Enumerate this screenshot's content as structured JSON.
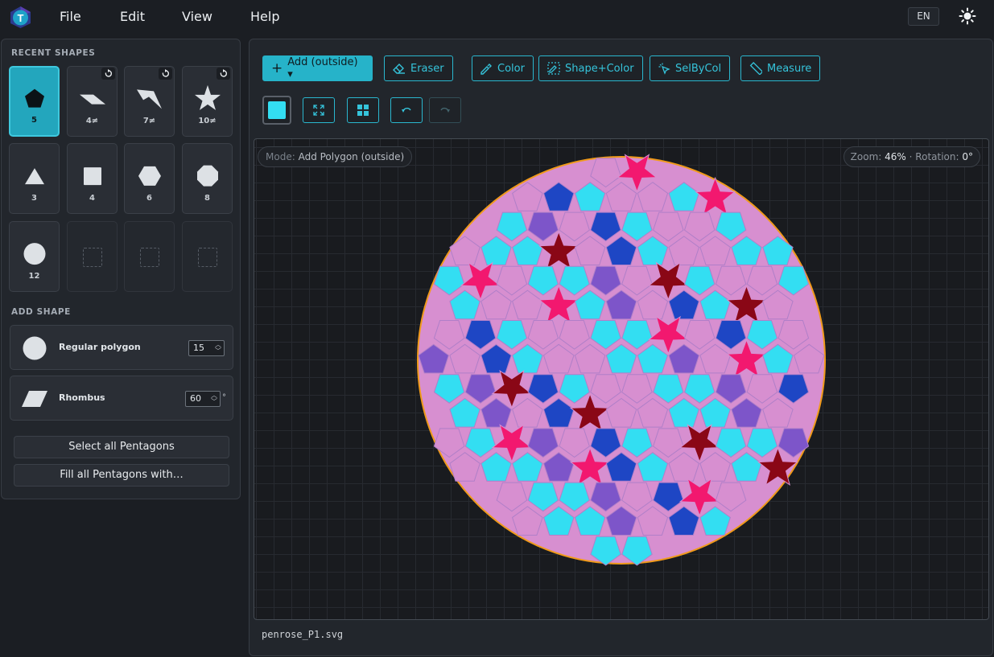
{
  "menu": {
    "file": "File",
    "edit": "Edit",
    "view": "View",
    "help": "Help",
    "lang": "EN",
    "logo_letter": "T"
  },
  "sidebar": {
    "recent_title": "RECENT SHAPES",
    "recent": [
      {
        "label": "5",
        "shape": "pentagon",
        "selected": true
      },
      {
        "label": "4≠",
        "shape": "rhombus-thin"
      },
      {
        "label": "7≠",
        "shape": "dart"
      },
      {
        "label": "10≠",
        "shape": "star"
      },
      {
        "label": "3",
        "shape": "triangle"
      },
      {
        "label": "4",
        "shape": "square"
      },
      {
        "label": "6",
        "shape": "hexagon"
      },
      {
        "label": "8",
        "shape": "octagon"
      },
      {
        "label": "12",
        "shape": "dodecagon"
      }
    ],
    "add_title": "ADD SHAPE",
    "regular_polygon": {
      "name": "Regular polygon",
      "value": "15"
    },
    "rhombus": {
      "name": "Rhombus",
      "value": "60",
      "unit": "°"
    },
    "select_all": "Select all Pentagons",
    "fill_all": "Fill all Pentagons with…"
  },
  "toolbar": {
    "add": "Add (outside) ▾",
    "eraser": "Eraser",
    "color": "Color",
    "shape_color": "Shape+Color",
    "selbycol": "SelByCol",
    "measure": "Measure",
    "current_color": "#33def2"
  },
  "canvas": {
    "mode_key": "Mode:",
    "mode_value": "Add Polygon (outside)",
    "zoom_key": "Zoom:",
    "zoom_value": "46%",
    "sep": "·",
    "rotation_key": "Rotation:",
    "rotation_value": "0°",
    "palette": {
      "cyan": "#33def2",
      "pink": "#d78fd0",
      "blue": "#1e46c4",
      "magenta": "#f2186f",
      "crimson": "#8a0716",
      "violet": "#7d55c9",
      "outline": "#f09a1b"
    }
  },
  "footer": {
    "filename": "penrose_P1.svg"
  }
}
